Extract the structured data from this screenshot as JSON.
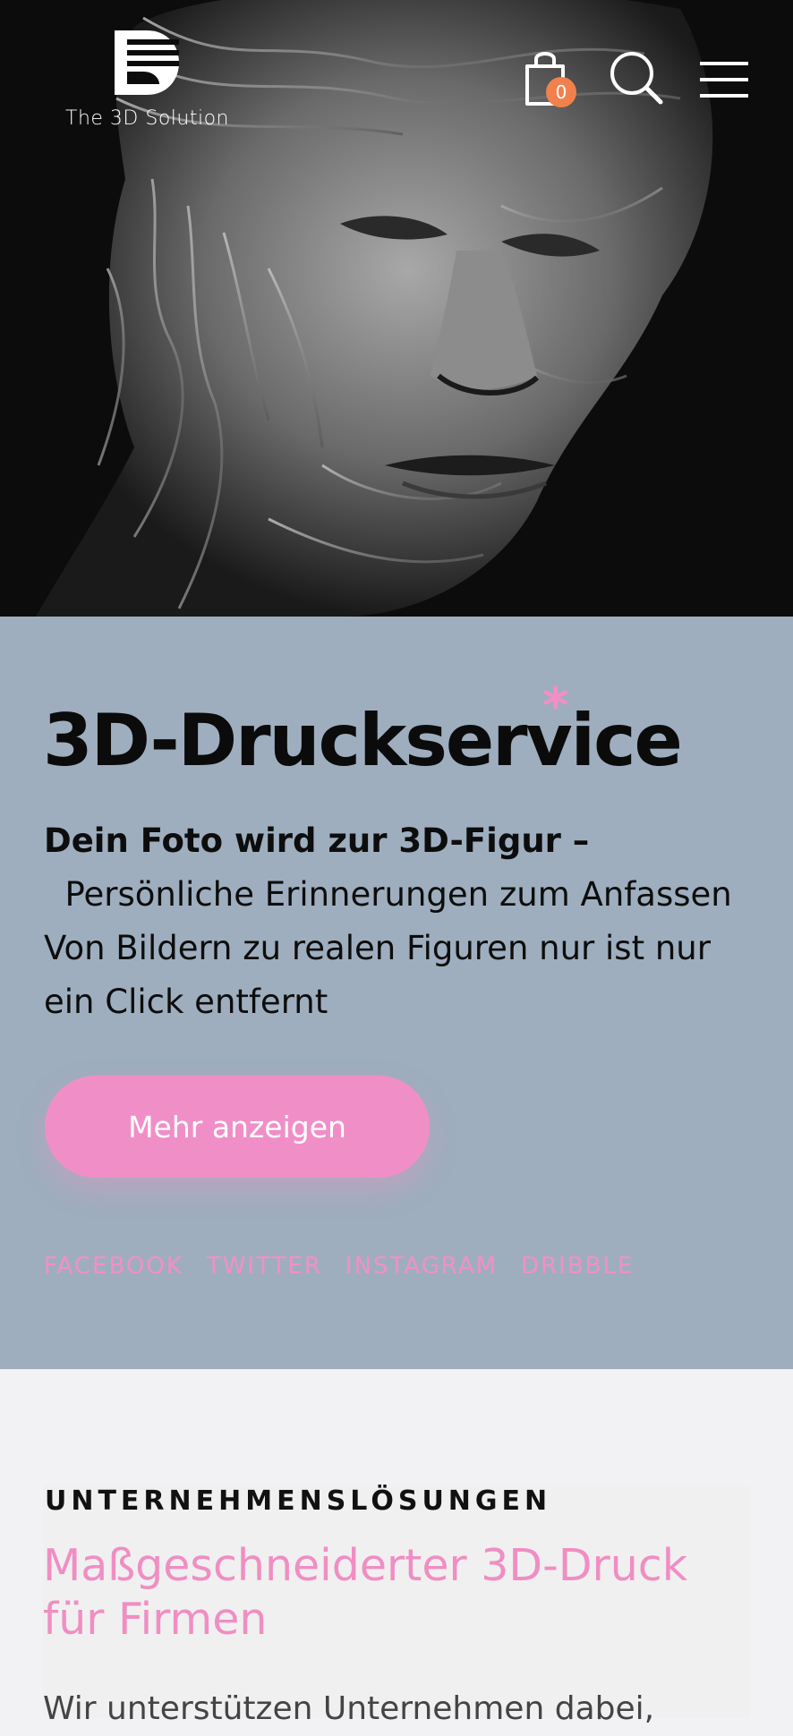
{
  "header": {
    "logo_text": "The 3D Solution",
    "cart_count": "0",
    "icons": [
      "logo-icon",
      "shopping-bag-icon",
      "search-icon",
      "hamburger-menu-icon"
    ]
  },
  "hero": {
    "image": "grayscale-sculpted-face-artwork"
  },
  "intro": {
    "title": "3D-Druckservice",
    "asterisk": "*",
    "lead_bold": "Dein Foto wird zur 3D-Figur –",
    "lead_line2": "Persönliche Erinnerungen zum Anfassen",
    "lead_line3": "Von Bildern zu realen Figuren nur ist nur",
    "lead_line4": "ein Click entfernt",
    "cta_label": "Mehr anzeigen",
    "social": [
      "FACEBOOK",
      "TWITTER",
      "INSTAGRAM",
      "DRIBBLE"
    ]
  },
  "business": {
    "eyebrow": "UNTERNEHMENSLÖSUNGEN",
    "title": "Maßgeschneiderter 3D-Druck für Firmen",
    "text": "Wir unterstützen Unternehmen dabei,"
  },
  "colors": {
    "accent_pink": "#f08fc7",
    "band_blue_gray": "#9eaebe",
    "badge_orange": "#f0814d",
    "hero_background": "#0c0c0c"
  }
}
